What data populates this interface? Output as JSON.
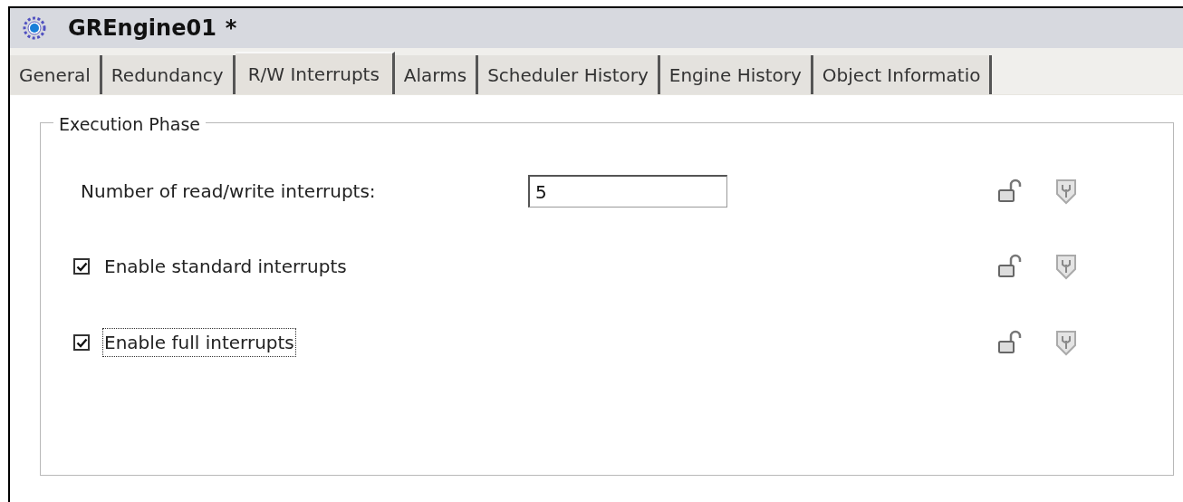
{
  "window": {
    "title": "GREngine01",
    "modified_mark": "*"
  },
  "tabs": [
    {
      "label": "General",
      "selected": false
    },
    {
      "label": "Redundancy",
      "selected": false
    },
    {
      "label": "R/W Interrupts",
      "selected": true
    },
    {
      "label": "Alarms",
      "selected": false
    },
    {
      "label": "Scheduler History",
      "selected": false
    },
    {
      "label": "Engine History",
      "selected": false
    },
    {
      "label": "Object Informatio",
      "selected": false
    }
  ],
  "group": {
    "title": "Execution Phase",
    "rows": [
      {
        "kind": "number",
        "label": "Number of read/write interrupts:",
        "value": "5"
      },
      {
        "kind": "checkbox",
        "label": "Enable standard interrupts",
        "checked": true,
        "focused": false
      },
      {
        "kind": "checkbox",
        "label": "Enable full interrupts",
        "checked": true,
        "focused": true
      }
    ]
  }
}
